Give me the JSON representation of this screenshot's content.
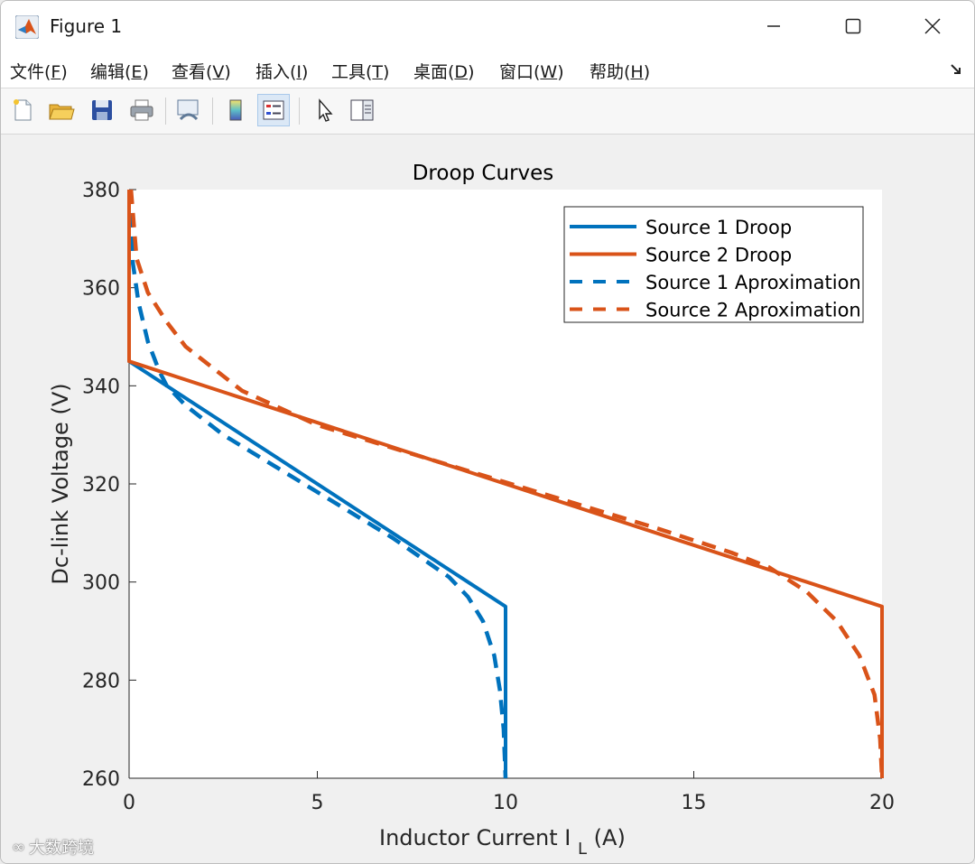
{
  "window": {
    "title": "Figure 1"
  },
  "menu": [
    {
      "label": "文件(",
      "key": "F",
      "tail": ")"
    },
    {
      "label": "编辑(",
      "key": "E",
      "tail": ")"
    },
    {
      "label": "查看(",
      "key": "V",
      "tail": ")"
    },
    {
      "label": "插入(",
      "key": "I",
      "tail": ")"
    },
    {
      "label": "工具(",
      "key": "T",
      "tail": ")"
    },
    {
      "label": "桌面(",
      "key": "D",
      "tail": ")"
    },
    {
      "label": "窗口(",
      "key": "W",
      "tail": ")"
    },
    {
      "label": "帮助(",
      "key": "H",
      "tail": ")"
    }
  ],
  "toolbar": [
    {
      "icon": "new-file-icon"
    },
    {
      "icon": "open-folder-icon"
    },
    {
      "icon": "save-icon"
    },
    {
      "icon": "print-icon"
    },
    {
      "icon": "link-plot-icon"
    },
    {
      "icon": "colorbar-icon"
    },
    {
      "icon": "legend-icon",
      "active": true
    },
    {
      "icon": "pointer-icon"
    },
    {
      "icon": "property-inspector-icon"
    }
  ],
  "watermark": "大数跨境",
  "chart_data": {
    "type": "line",
    "title": "Droop Curves",
    "xlabel": "Inductor Current I",
    "xlabel_subscript": "L",
    "xlabel_tail": " (A)",
    "ylabel": "Dc-link Voltage (V)",
    "xlim": [
      0,
      20
    ],
    "ylim": [
      260,
      380
    ],
    "xticks": [
      0,
      5,
      10,
      15,
      20
    ],
    "yticks": [
      260,
      280,
      300,
      320,
      340,
      360,
      380
    ],
    "grid": false,
    "legend_position": "top-right",
    "colors": {
      "source1": "#0072BD",
      "source2": "#D95319"
    },
    "series": [
      {
        "name": "Source 1 Droop",
        "style": "solid",
        "color": "#0072BD",
        "x": [
          0,
          0,
          10,
          10
        ],
        "y": [
          380,
          345,
          295,
          260
        ]
      },
      {
        "name": "Source 2 Droop",
        "style": "solid",
        "color": "#D95319",
        "x": [
          0,
          0,
          20,
          20
        ],
        "y": [
          380,
          345,
          295,
          260
        ]
      },
      {
        "name": "Source 1 Aproximation",
        "style": "dashed",
        "color": "#0072BD",
        "x": [
          0.02,
          0.1,
          0.25,
          0.5,
          0.8,
          1.0,
          1.5,
          2.5,
          4,
          5.5,
          7,
          8.5,
          9.0,
          9.4,
          9.7,
          9.85,
          9.95,
          10.0
        ],
        "y": [
          380,
          365,
          357,
          349,
          343,
          340,
          336,
          330,
          323,
          316,
          309,
          301,
          297,
          292,
          285,
          278,
          270,
          260
        ]
      },
      {
        "name": "Source 2 Aproximation",
        "style": "dashed",
        "color": "#D95319",
        "x": [
          0.05,
          0.2,
          0.5,
          1.0,
          1.5,
          2.0,
          3,
          5,
          8,
          11,
          14,
          16,
          17,
          18,
          18.8,
          19.4,
          19.8,
          19.95,
          20.0
        ],
        "y": [
          380,
          366,
          359,
          353,
          348,
          345,
          339,
          332,
          325,
          318,
          311,
          306,
          303,
          298,
          292,
          285,
          277,
          268,
          260
        ]
      }
    ]
  }
}
